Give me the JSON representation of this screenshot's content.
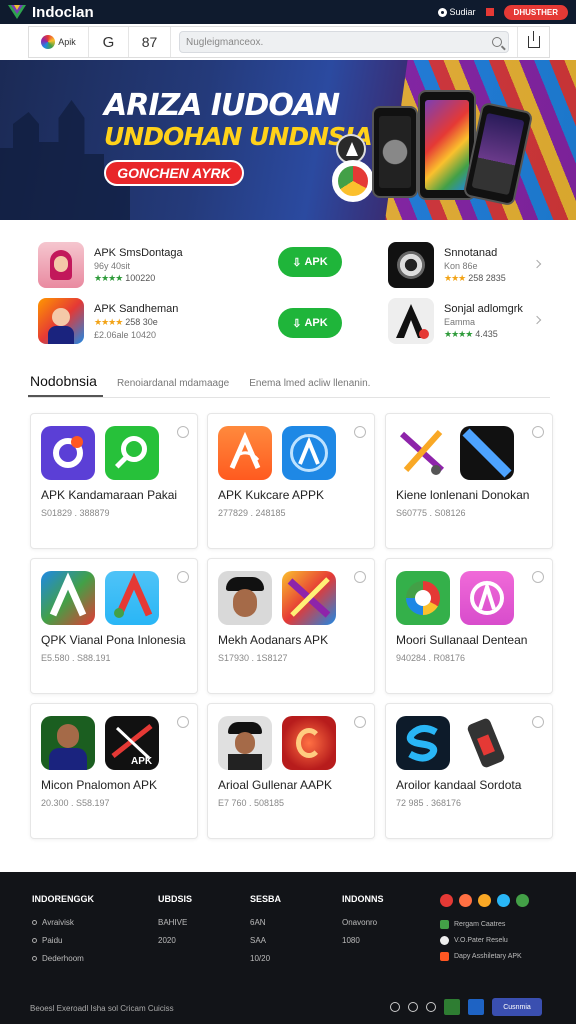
{
  "topbar": {
    "brand": "Indoclan",
    "link1": "Sudiar",
    "link2": " ",
    "cta": "DHUSTHER"
  },
  "nav": {
    "logo_text": "Apik",
    "g_label": "G",
    "num_label": "87",
    "search_placeholder": "Nugleigmanceox."
  },
  "banner": {
    "title_line1": "ARIZA IUDOAN",
    "title_line2": "UNDOHAN UNDNSIA'",
    "cta": "GONCHEN AYRK"
  },
  "featured": [
    {
      "title": "APK SmsDontaga",
      "sub": "96y 40sit",
      "stars": "★★★★",
      "rating": "100220"
    },
    {
      "title": "APK Sandheman",
      "stars": "★★★★",
      "rating": "258 30e",
      "sub": "£2.06ale  10420"
    },
    {
      "title": "Snnotanad",
      "sub": "Kon 86e",
      "stars": "★★★",
      "rating": "258 2835"
    },
    {
      "title": "Sonjal adlomgrk",
      "sub": "Eamma",
      "stars": "★★★★",
      "rating": "4.435"
    }
  ],
  "apk_button": "APK",
  "tabs": [
    {
      "label": "Nodobnsia"
    },
    {
      "label": "Renoiardanal mdamaage"
    },
    {
      "label": "Enema lmed acliw llenanin."
    }
  ],
  "cards": [
    {
      "title": "APK Kandamaraan Pakai",
      "meta": "S01829 . 388879"
    },
    {
      "title": "APK Kukcare APPK",
      "meta": "277829 . 248185"
    },
    {
      "title": "Kiene lonlenani Donokan",
      "meta": "S60775 . S08126"
    },
    {
      "title": "QPK Vianal Pona Inlonesia",
      "meta": "E5.580 . S88.191"
    },
    {
      "title": "Mekh Aodanars APK",
      "meta": "S17930 . 1S8127"
    },
    {
      "title": "Moori Sullanaal Dentean",
      "meta": "940284 . R08176"
    },
    {
      "title": "Micon Pnalomon APK",
      "meta": "20.300 . S58.197"
    },
    {
      "title": "Arioal Gullenar AAPK",
      "meta": "E7 760 . 508185"
    },
    {
      "title": "Aroilor kandaal Sordota",
      "meta": "72 985 . 368176"
    }
  ],
  "footer": {
    "col1": {
      "head": "INDORENGGK",
      "items": [
        "Avraivisk",
        "Paidu",
        "Dederhoom"
      ]
    },
    "col2": {
      "head": "UBDSIS",
      "items": [
        "BAHIVE",
        "2020"
      ]
    },
    "col3": {
      "head": "SESBA",
      "items": [
        "6AN",
        "SAA",
        "10/20"
      ]
    },
    "col4": {
      "head": "INDONNS",
      "items": [
        "Onavonro",
        "1080"
      ]
    },
    "links": [
      "Rergam Caatres",
      "V.O.Pater Reselu",
      "Dapy Asshiletary APK"
    ],
    "copyright": "Beoesl Exeroadl Isha sol Cricam Cuiciss",
    "store_label": "Cusnmia"
  },
  "colors": {
    "accent_green": "#1fb53a",
    "accent_red": "#e8272a",
    "banner_yellow": "#ffd21a",
    "dark": "#121418"
  }
}
